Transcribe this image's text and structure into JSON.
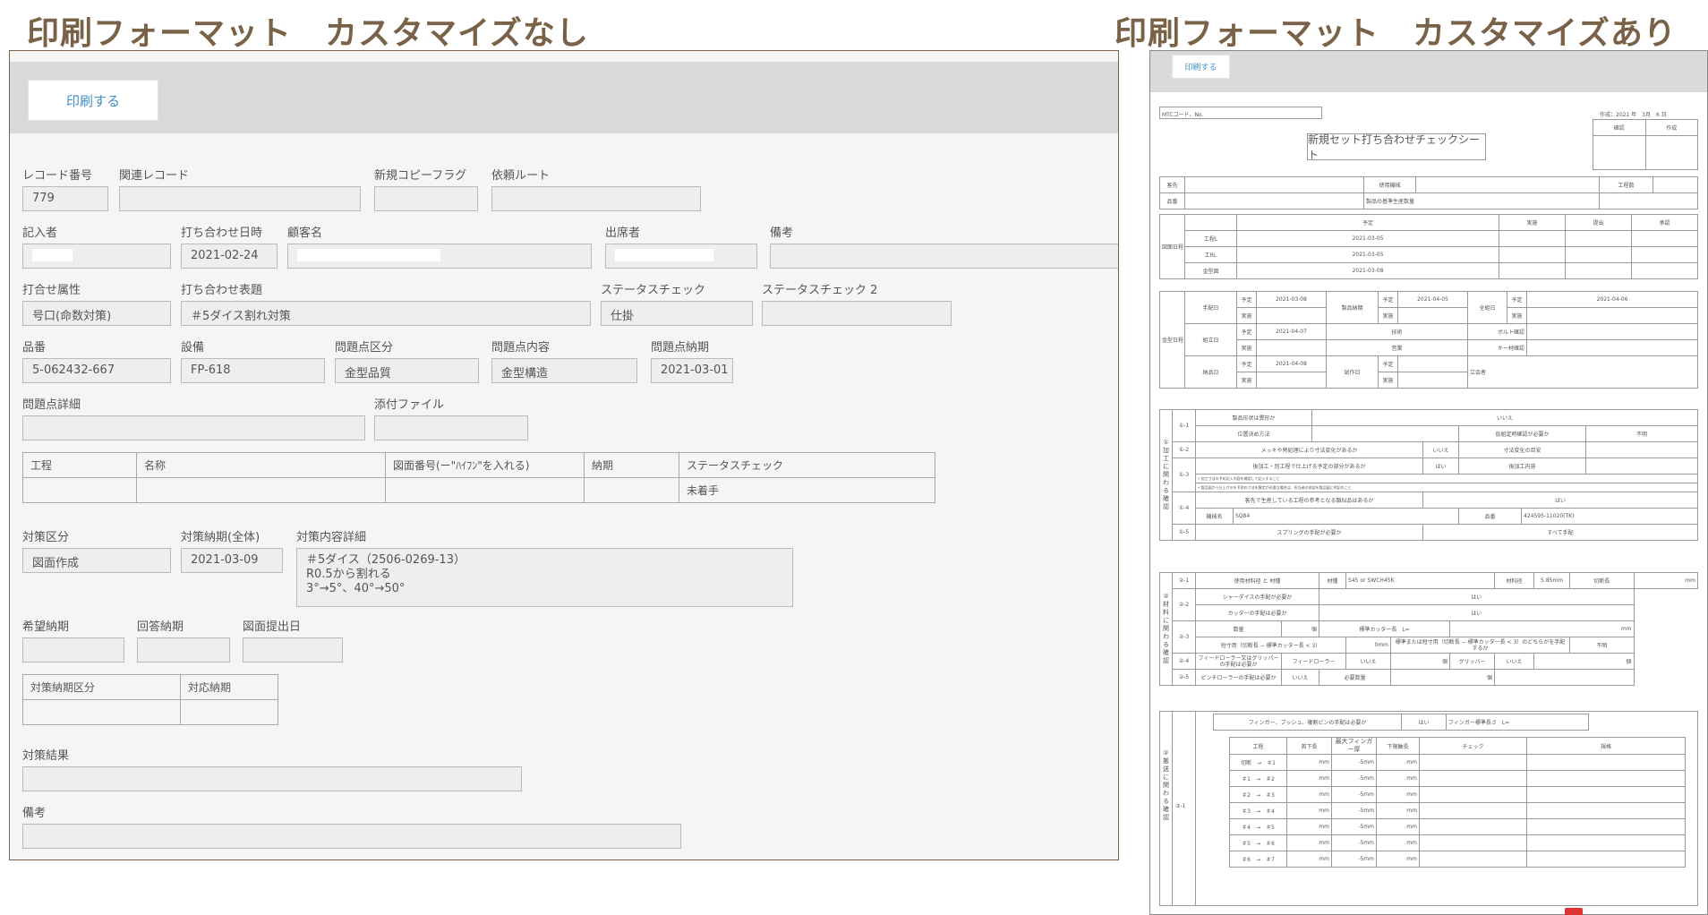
{
  "headings": {
    "left": "印刷フォーマット　カスタマイズなし",
    "right": "印刷フォーマット　カスタマイズあり"
  },
  "left": {
    "print_button": "印刷する",
    "labels": {
      "record_no": "レコード番号",
      "related_record": "関連レコード",
      "copy_flag": "新規コピーフラグ",
      "request_route": "依頼ルート",
      "writer": "記入者",
      "meeting_date": "打ち合わせ日時",
      "customer": "顧客名",
      "attendee": "出席者",
      "remarks": "備考",
      "meeting_attr": "打合せ属性",
      "meeting_title": "打ち合わせ表題",
      "status_check": "ステータスチェック",
      "status_check2": "ステータスチェック 2",
      "part_no": "品番",
      "equipment": "設備",
      "issue_category": "問題点区分",
      "issue_content": "問題点内容",
      "issue_deadline": "問題点納期",
      "issue_detail": "問題点詳細",
      "attachment": "添付ファイル",
      "measure_category": "対策区分",
      "measure_deadline_all": "対策納期(全体)",
      "measure_detail": "対策内容詳細",
      "desired_deadline": "希望納期",
      "answer_deadline": "回答納期",
      "drawing_submit": "図面提出日",
      "measure_result": "対策結果",
      "remarks2": "備考"
    },
    "values": {
      "record_no": "779",
      "meeting_date": "2021-02-24",
      "meeting_attr": "号口(命数対策)",
      "meeting_title": "＃5ダイス割れ対策",
      "status_check": "仕掛",
      "part_no": "5-062432-667",
      "equipment": "FP-618",
      "issue_category": "金型品質",
      "issue_content": "金型構造",
      "issue_deadline": "2021-03-01",
      "measure_category": "図面作成",
      "measure_deadline_all": "2021-03-09",
      "measure_detail": "＃5ダイス（2506-0269-13）\nR0.5から割れる\n3°→5°、40°→50°"
    },
    "process_table": {
      "headers": [
        "工程",
        "名称",
        "図面番号(ー\"ﾊｲﾌﾝ\"を入れる)",
        "納期",
        "ステータスチェック"
      ],
      "row": [
        "",
        "",
        "",
        "",
        "未着手"
      ]
    },
    "deadline_table": {
      "headers": [
        "対策納期区分",
        "対応納期"
      ]
    }
  },
  "right": {
    "print_button": "印刷する",
    "mtc": "MTCコード、No.",
    "created": "作成：2021 年　3月　6 日",
    "confirm": "確認",
    "make": "作成",
    "sheet_title": "新規セット打ち合わせチェックシート",
    "top": {
      "customer": "客先",
      "machine": "使用機械",
      "process_count": "工程数",
      "part": "品番",
      "base": "製品の基準生産数量"
    },
    "sched": {
      "label": "図面日程",
      "headers": [
        "予定",
        "実施",
        "提出",
        "承認"
      ],
      "rows": [
        [
          "工程L",
          "2021-03-05"
        ],
        [
          "工RL",
          "2021-03-05"
        ],
        [
          "金型図",
          "2021-03-08"
        ]
      ]
    },
    "mold": {
      "label": "金型日程",
      "plan": "予定",
      "done": "実施",
      "g1": [
        "手配日",
        "2021-03-08",
        "製品納期",
        "2021-04-05",
        "全組日",
        "2021-04-06"
      ],
      "g2": [
        "組立日",
        "2021-04-07",
        "技術",
        "",
        "ボルト確認",
        ""
      ],
      "g2b": [
        "",
        "",
        "営業",
        "",
        "キー材確認",
        ""
      ],
      "g3": [
        "納品日",
        "2021-04-08",
        "試作日",
        "",
        "立会者",
        ""
      ]
    },
    "s1": {
      "title": "①加工に関わる確認",
      "r11a": [
        "①-1",
        "製品形状は異形か",
        "いいえ"
      ],
      "r11b": [
        "位置決め方法",
        "仮組定時確認が必要か",
        "不明"
      ],
      "r12": [
        "①-2",
        "メッキや熱処理により寸法変化があるか",
        "いいえ",
        "寸法変化の目安"
      ],
      "r13a": [
        "①-3",
        "後加工・別工程で仕上げる予定の部分があるか",
        "はい",
        "後加工内容"
      ],
      "note1": "• 加工寸法の予め記入内容を確認して記入すること",
      "note2": "• 製品図から仕上げるを予測の寸法を算定が必要な場合は、担当者の承認を製品図に明記のこと",
      "r14a": [
        "①-4",
        "客先で生産している工程の参考となる類似品はあるか",
        "はい"
      ],
      "r14b": [
        "機械名",
        "SQ84",
        "品番",
        "424595-11020(TK)"
      ],
      "r15": [
        "①-5",
        "スプリングの手配が必要か",
        "すべて手配"
      ]
    },
    "s2": {
      "title": "②材料に関わる確認",
      "r21": [
        "②-1",
        "使用材料径 と 材種",
        "材種",
        "S45 or SWCH45K",
        "材料径",
        "5.85mm",
        "切断長",
        "mm"
      ],
      "r22a": [
        "②-2",
        "シャーダイスの手配が必要か",
        "はい"
      ],
      "r22b": [
        "カッターの手配は必要か",
        "はい"
      ],
      "r23a": [
        "②-3",
        "数量",
        "個",
        "標準カッター長　L=",
        "mm"
      ],
      "r23b": [
        "短寸用（切断長 − 標準カッター長 < 3）",
        "0mm",
        "標準または短寸用（切断長 − 標準カッター長 < 3）のどちらかを手配するか",
        "不明"
      ],
      "r24": [
        "②-4",
        "フィードローラー又はグリッパーの手配は必要か",
        "フィードローラー",
        "いいえ",
        "個",
        "グリッパー",
        "いいえ",
        "個"
      ],
      "r25": [
        "②-5",
        "ピンチローラーの手配は必要か",
        "いいえ",
        "必要数量",
        "個"
      ]
    },
    "s3": {
      "title": "③搬送に関わる確認",
      "id": "③-1",
      "finger": [
        "フィンガー、ブッシュ、複割ピンの手配は必要か",
        "はい",
        "フィンガー標準長さ　L="
      ],
      "headers": [
        "工程",
        "首下長",
        "最大フィンガー厚",
        "下限軸長",
        "チェック",
        "規格"
      ],
      "rows": [
        [
          "切断　→　＃1",
          "mm",
          "-5mm",
          "mm"
        ],
        [
          "＃1　→　＃2",
          "mm",
          "-5mm",
          "mm"
        ],
        [
          "＃2　→　＃3",
          "mm",
          "-5mm",
          "mm"
        ],
        [
          "＃3　→　＃4",
          "mm",
          "-5mm",
          "mm"
        ],
        [
          "＃4　→　＃5",
          "mm",
          "-5mm",
          "mm"
        ],
        [
          "＃5　→　＃6",
          "mm",
          "-5mm",
          "mm"
        ],
        [
          "＃6　→　＃7",
          "mm",
          "-5mm",
          "mm"
        ]
      ]
    }
  }
}
